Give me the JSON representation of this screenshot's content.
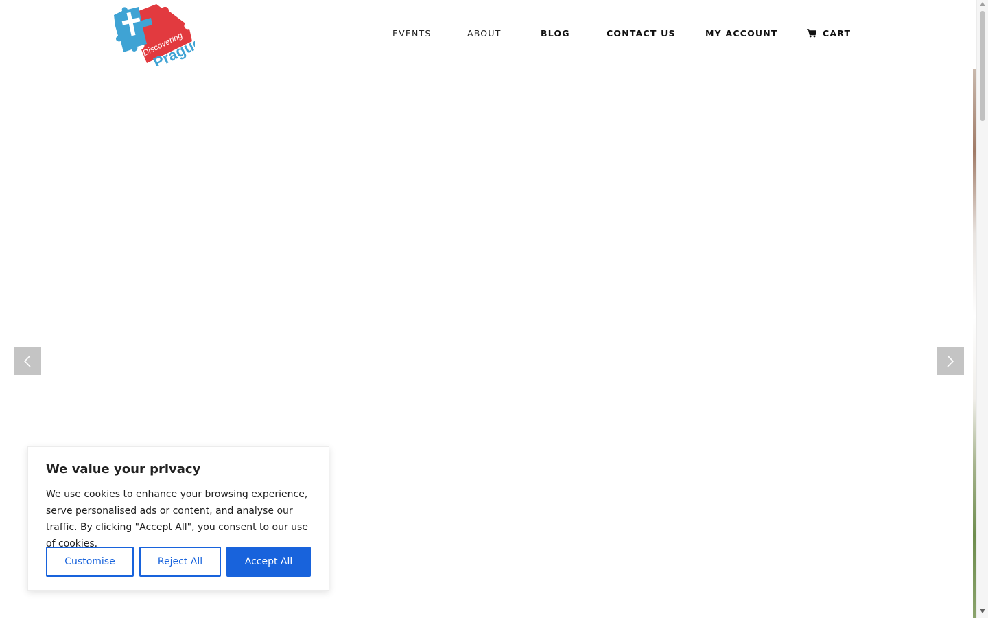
{
  "header": {
    "logo_alt": "Discovering Prague",
    "nav": {
      "events": "EVENTS",
      "about": "ABOUT",
      "blog": "BLOG",
      "contact": "CONTACT US",
      "account": "MY ACCOUNT",
      "cart": "CART"
    },
    "icons": {
      "cart": "cart-icon"
    }
  },
  "slider": {
    "prev_icon": "chevron-left-icon",
    "next_icon": "chevron-right-icon"
  },
  "cookie_banner": {
    "title": "We value your privacy",
    "text": "We use cookies to enhance your browsing experience, serve personalised ads or content, and analyse our traffic. By clicking \"Accept All\", you consent to our use of cookies.",
    "customise": "Customise",
    "reject": "Reject All",
    "accept": "Accept All",
    "accent_color": "#1863dc"
  }
}
